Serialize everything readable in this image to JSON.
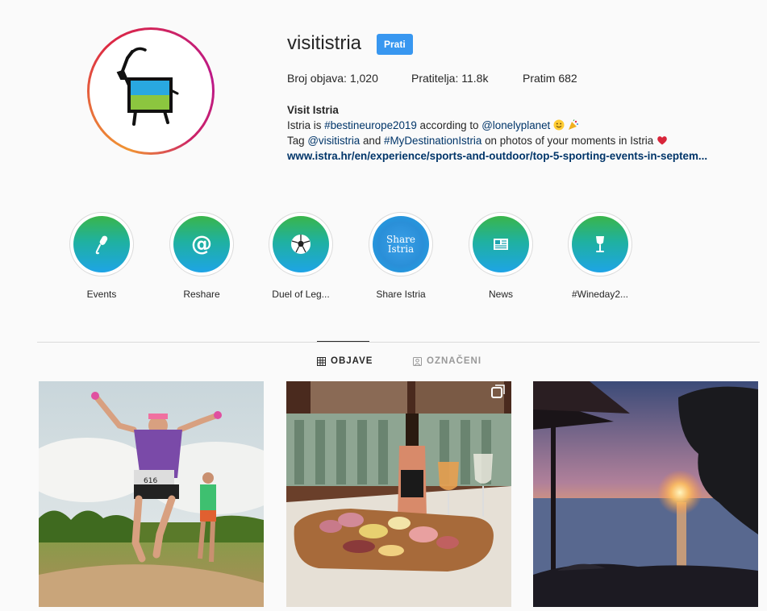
{
  "profile": {
    "username": "visitistria",
    "follow_label": "Prati",
    "posts": "Broj objava: 1,020",
    "followers": "Pratitelja: 11.8k",
    "following": "Pratim 682",
    "name": "Visit Istria",
    "bio_line1_pre": "Istria is ",
    "bio_line1_tag": "#bestineurope2019",
    "bio_line1_mid": " according to ",
    "bio_line1_mention": "@lonelyplanet",
    "bio_line2_pre": "Tag ",
    "bio_line2_mention": "@visitistria",
    "bio_line2_mid": " and ",
    "bio_line2_tag": "#MyDestinationIstria",
    "bio_line2_post": " on photos of your moments in Istria",
    "link": "www.istra.hr/en/experience/sports-and-outdoor/top-5-sporting-events-in-septem..."
  },
  "highlights": [
    {
      "label": "Events",
      "icon": "microphone-icon"
    },
    {
      "label": "Reshare",
      "icon": "at-sign-icon"
    },
    {
      "label": "Duel of Leg...",
      "icon": "soccer-ball-icon"
    },
    {
      "label": "Share Istria",
      "icon": "share-istria-logo",
      "logo_text_1": "Share",
      "logo_text_2": "Istria"
    },
    {
      "label": "News",
      "icon": "newspaper-icon"
    },
    {
      "label": "#Wineday2...",
      "icon": "wine-glass-icon"
    }
  ],
  "tabs": [
    {
      "label": "OBJAVE",
      "icon": "grid-icon"
    },
    {
      "label": "OZNAČENI",
      "icon": "tagged-icon"
    }
  ],
  "posts": [
    {
      "subject": "trail-runners-photo"
    },
    {
      "subject": "wine-and-charcuterie-photo",
      "multi": true
    },
    {
      "subject": "sunset-sea-photo"
    }
  ],
  "colors": {
    "follow_button": "#3897f0",
    "highlight_gradient_top": "#3ab54a",
    "highlight_gradient_bottom": "#1ea4e6",
    "link_color": "#003569"
  }
}
